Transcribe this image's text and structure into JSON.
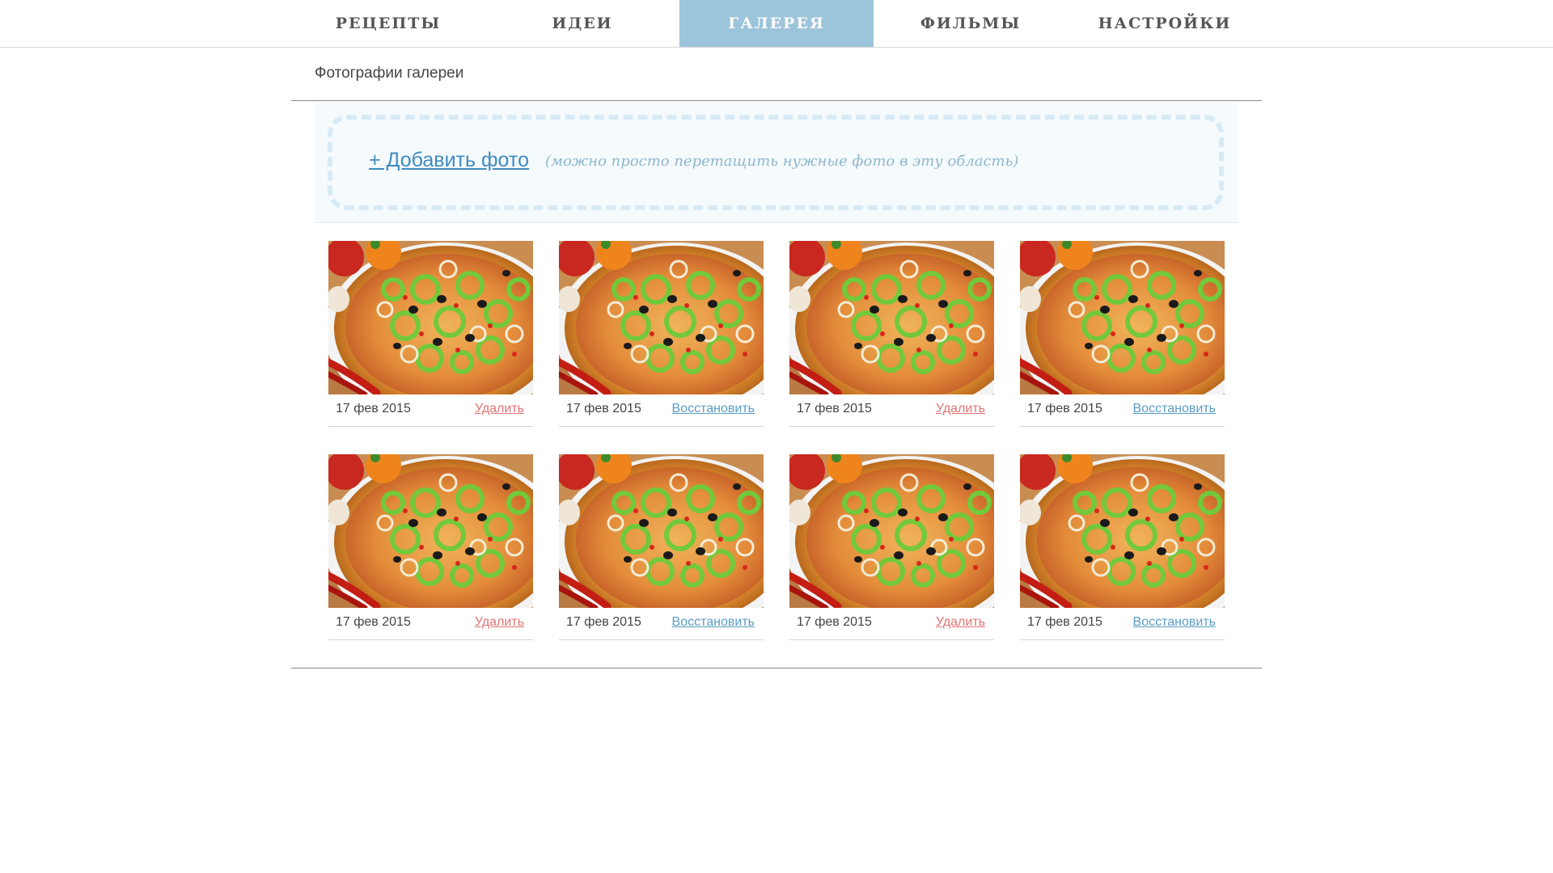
{
  "nav": {
    "tabs": [
      {
        "label": "РЕЦЕПТЫ",
        "active": false
      },
      {
        "label": "ИДЕИ",
        "active": false
      },
      {
        "label": "ГАЛЕРЕЯ",
        "active": true
      },
      {
        "label": "ФИЛЬМЫ",
        "active": false
      },
      {
        "label": "НАСТРОЙКИ",
        "active": false
      }
    ],
    "active_color": "#9cc4da"
  },
  "section": {
    "title": "Фотографии галереи"
  },
  "upload": {
    "add_label": "+ Добавить фото",
    "hint": "(можно просто перетащить нужные фото в эту область)"
  },
  "gallery": {
    "items": [
      {
        "date": "17 фев 2015",
        "action": "Удалить",
        "action_type": "delete"
      },
      {
        "date": "17 фев 2015",
        "action": "Восстановить",
        "action_type": "restore"
      },
      {
        "date": "17 фев 2015",
        "action": "Удалить",
        "action_type": "delete"
      },
      {
        "date": "17 фев 2015",
        "action": "Восстановить",
        "action_type": "restore"
      },
      {
        "date": "17 фев 2015",
        "action": "Удалить",
        "action_type": "delete"
      },
      {
        "date": "17 фев 2015",
        "action": "Восстановить",
        "action_type": "restore"
      },
      {
        "date": "17 фев 2015",
        "action": "Удалить",
        "action_type": "delete"
      },
      {
        "date": "17 фев 2015",
        "action": "Восстановить",
        "action_type": "restore"
      }
    ],
    "photo_subject": "pizza-photo",
    "delete_color": "#e07373",
    "restore_color": "#5a9cc5"
  }
}
